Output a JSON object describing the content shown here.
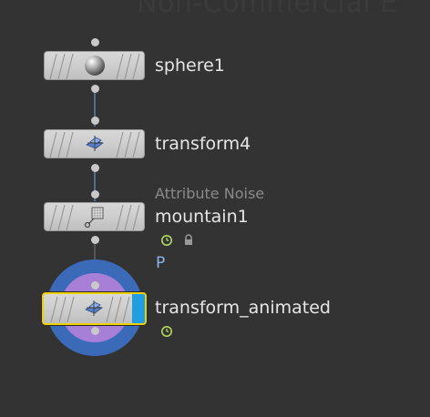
{
  "watermark": "Non-Commercial E",
  "nodes": [
    {
      "name": "sphere1",
      "icon": "sphere-icon"
    },
    {
      "name": "transform4",
      "icon": "transform-icon"
    },
    {
      "name": "mountain1",
      "type_label": "Attribute Noise",
      "icon": "attribute-noise-icon",
      "badges": [
        "time-dependent-icon",
        "lock-icon"
      ]
    },
    {
      "name": "transform_animated",
      "icon": "transform-icon",
      "badges": [
        "time-dependent-icon"
      ],
      "selected": true,
      "display_flag": true
    }
  ],
  "attribute_hint": "P",
  "colors": {
    "background": "#333333",
    "node_body": "#cfcfcf",
    "selected_outline": "#f0d000",
    "display_flag": "#1e9fe4",
    "highlight_ring_outer": "#3a6ab8",
    "highlight_ring_inner": "#a87fd6",
    "time_badge": "#b5d85a"
  }
}
